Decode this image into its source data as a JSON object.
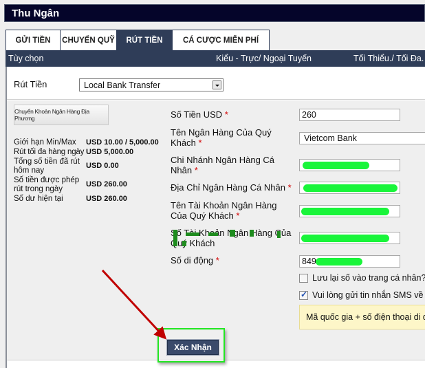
{
  "window": {
    "title": "Thu Ngân"
  },
  "tabs": [
    {
      "label": "GỬI TIỀN",
      "active": false
    },
    {
      "label": "CHUYỂN QUỸ",
      "active": false
    },
    {
      "label": "RÚT TIỀN",
      "active": true
    },
    {
      "label": "CÁ CƯỢC MIỄN PHÍ",
      "active": false
    }
  ],
  "header": {
    "option": "Tùy chọn",
    "type": "Kiểu - Trực/ Ngoại Tuyến",
    "minmax": "Tối Thiểu./ Tối Đa."
  },
  "method": {
    "label": "Rút Tiền",
    "selected": "Local Bank Transfer"
  },
  "bank_button": {
    "label": "Chuyển Khoản Ngân Hàng Địa Phương"
  },
  "limits": [
    {
      "label": "Giới hạn Min/Max",
      "value": "USD 10.00 / 5,000.00"
    },
    {
      "label": "Rút tối đa hàng ngày",
      "value": "USD 5,000.00"
    },
    {
      "label": "Tổng số tiền đã rút hôm nay",
      "value": "USD 0.00"
    },
    {
      "label": "Số tiền được phép rút trong ngày",
      "value": "USD 260.00"
    },
    {
      "label": "Số dư hiện tại",
      "value": "USD 260.00"
    }
  ],
  "form": {
    "amount": {
      "label": "Số Tiền USD",
      "value": "260"
    },
    "bank_name": {
      "label": "Tên Ngân Hàng Của Quý Khách",
      "value": "Vietcom Bank"
    },
    "branch": {
      "label": "Chi Nhánh Ngân Hàng Cá Nhân",
      "value": ""
    },
    "address": {
      "label": "Địa Chỉ Ngân Hàng Cá Nhân",
      "value": ""
    },
    "account_name": {
      "label": "Tên Tài Khoản Ngân Hàng Của Quý Khách",
      "value": ""
    },
    "account_number": {
      "label": "Số Tài Khoản Ngân Hàng Của Quý Khách",
      "value": ""
    },
    "mobile": {
      "label": "Số di động",
      "value": "849"
    },
    "required_mark": "*",
    "save_checkbox": {
      "label": "Lưu lại số vào trang cá nhân?",
      "checked": false
    },
    "sms_checkbox": {
      "label": "Vui lòng gửi tin nhắn SMS về",
      "checked": true
    },
    "notice": "Mã quốc gia + số điện thoại di động"
  },
  "confirm_button": {
    "label": "Xác Nhận"
  },
  "colors": {
    "titlebar": "#05052a",
    "tab_active": "#2f3d58",
    "highlight": "#22e622",
    "arrow": "#c00000"
  }
}
